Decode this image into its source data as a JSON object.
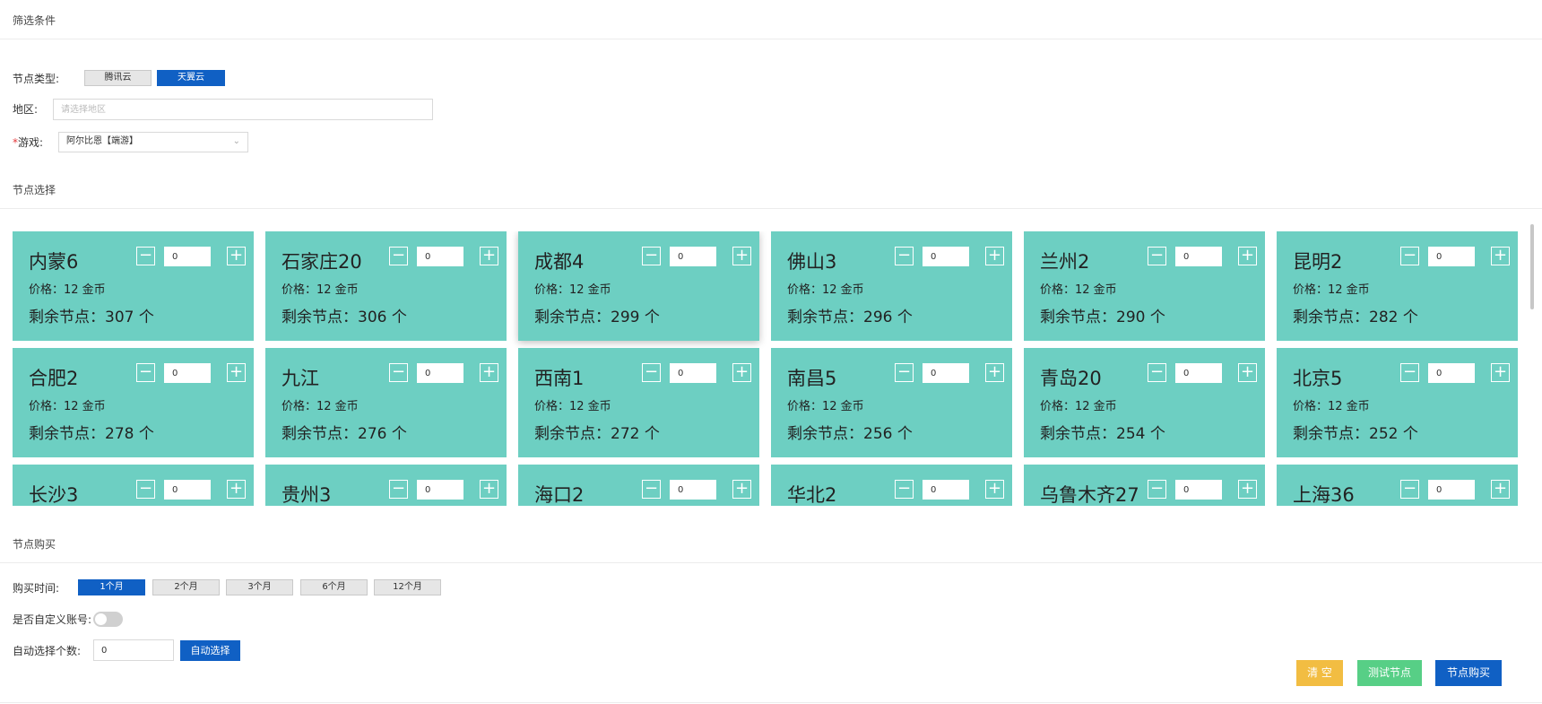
{
  "sections": {
    "filter": "筛选条件",
    "node_select": "节点选择",
    "purchase": "节点购买"
  },
  "filter": {
    "node_type_label": "节点类型:",
    "node_types": [
      "腾讯云",
      "天翼云"
    ],
    "node_type_selected": "天翼云",
    "region_label": "地区:",
    "region_placeholder": "请选择地区",
    "game_required_mark": "*",
    "game_label": "游戏:",
    "game_value": "阿尔比恩【端游】"
  },
  "nodes": [
    {
      "name": "内蒙6",
      "price": "价格：12 金币",
      "remaining": "剩余节点：307 个",
      "qty": "0"
    },
    {
      "name": "石家庄20",
      "price": "价格：12 金币",
      "remaining": "剩余节点：306 个",
      "qty": "0"
    },
    {
      "name": "成都4",
      "price": "价格：12 金币",
      "remaining": "剩余节点：299 个",
      "qty": "0"
    },
    {
      "name": "佛山3",
      "price": "价格：12 金币",
      "remaining": "剩余节点：296 个",
      "qty": "0"
    },
    {
      "name": "兰州2",
      "price": "价格：12 金币",
      "remaining": "剩余节点：290 个",
      "qty": "0"
    },
    {
      "name": "昆明2",
      "price": "价格：12 金币",
      "remaining": "剩余节点：282 个",
      "qty": "0"
    },
    {
      "name": "合肥2",
      "price": "价格：12 金币",
      "remaining": "剩余节点：278 个",
      "qty": "0"
    },
    {
      "name": "九江",
      "price": "价格：12 金币",
      "remaining": "剩余节点：276 个",
      "qty": "0"
    },
    {
      "name": "西南1",
      "price": "价格：12 金币",
      "remaining": "剩余节点：272 个",
      "qty": "0"
    },
    {
      "name": "南昌5",
      "price": "价格：12 金币",
      "remaining": "剩余节点：256 个",
      "qty": "0"
    },
    {
      "name": "青岛20",
      "price": "价格：12 金币",
      "remaining": "剩余节点：254 个",
      "qty": "0"
    },
    {
      "name": "北京5",
      "price": "价格：12 金币",
      "remaining": "剩余节点：252 个",
      "qty": "0"
    },
    {
      "name": "长沙3",
      "price": "",
      "remaining": "",
      "qty": "0"
    },
    {
      "name": "贵州3",
      "price": "",
      "remaining": "",
      "qty": "0"
    },
    {
      "name": "海口2",
      "price": "",
      "remaining": "",
      "qty": "0"
    },
    {
      "name": "华北2",
      "price": "",
      "remaining": "",
      "qty": "0"
    },
    {
      "name": "乌鲁木齐27",
      "price": "",
      "remaining": "",
      "qty": "0"
    },
    {
      "name": "上海36",
      "price": "",
      "remaining": "",
      "qty": "0"
    }
  ],
  "stepper": {
    "minus": "−",
    "plus": "+"
  },
  "purchase": {
    "time_label": "购买时间:",
    "durations": [
      "1个月",
      "2个月",
      "3个月",
      "6个月",
      "12个月"
    ],
    "duration_selected": "1个月",
    "custom_account_label": "是否自定义账号:",
    "custom_account_enabled": false,
    "auto_count_label": "自动选择个数:",
    "auto_count_value": "0",
    "auto_select_button": "自动选择"
  },
  "actions": {
    "clear": "清 空",
    "test": "测试节点",
    "buy": "节点购买"
  },
  "colors": {
    "card_bg": "#6dcfc2",
    "primary": "#1060c4",
    "clear_btn": "#f2bd42",
    "test_btn": "#57cf86",
    "buy_btn": "#1060c4"
  }
}
